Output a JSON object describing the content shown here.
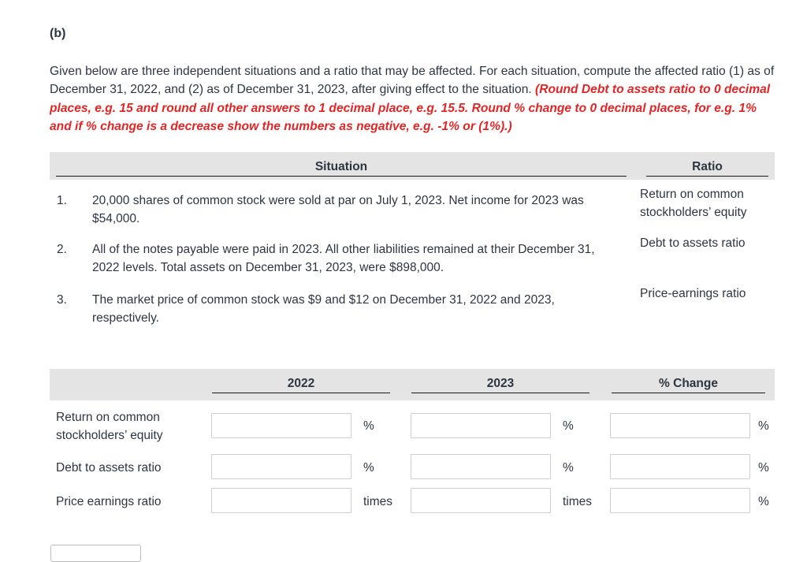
{
  "part_label": "(b)",
  "instructions": {
    "text": "Given below are three independent situations and a ratio that may be affected. For each situation, compute the affected ratio (1) as of December 31, 2022, and (2) as of December 31, 2023, after giving effect to the situation. ",
    "red_note": "(Round Debt to assets ratio to 0 decimal places, e.g. 15 and round all other answers to 1 decimal place, e.g. 15.5. Round % change to 0 decimal places, for e.g. 1% and if % change is a decrease show the numbers as negative, e.g. -1% or (1%).)",
    "note_color": "#e32526"
  },
  "situation_table": {
    "headers": {
      "situation": "Situation",
      "ratio": "Ratio"
    },
    "rows": [
      {
        "number": "1.",
        "text": "20,000 shares of common stock were sold at par on July 1, 2023. Net income for 2023 was $54,000.",
        "ratio": "Return on common stockholders’ equity"
      },
      {
        "number": "2.",
        "text": "All of the notes payable were paid in 2023. All other liabilities remained at their December 31, 2022 levels. Total assets on December 31, 2023, were $898,000.",
        "ratio": "Debt to assets ratio"
      },
      {
        "number": "3.",
        "text": "The market price of common stock was $9 and $12 on December 31, 2022 and 2023, respectively.",
        "ratio": "Price-earnings ratio"
      }
    ]
  },
  "answer_table": {
    "headers": {
      "y2022": "2022",
      "y2023": "2023",
      "change": "% Change"
    },
    "rows": [
      {
        "label": "Return on common stockholders’ equity",
        "v2022": "",
        "unit2022": "%",
        "v2023": "",
        "unit2023": "%",
        "change": "",
        "unit_change": "%"
      },
      {
        "label": "Debt to assets ratio",
        "v2022": "",
        "unit2022": "%",
        "v2023": "",
        "unit2023": "%",
        "change": "",
        "unit_change": "%"
      },
      {
        "label": "Price earnings ratio",
        "v2022": "",
        "unit2022": "times",
        "v2023": "",
        "unit2023": "times",
        "change": "",
        "unit_change": "%"
      }
    ]
  }
}
